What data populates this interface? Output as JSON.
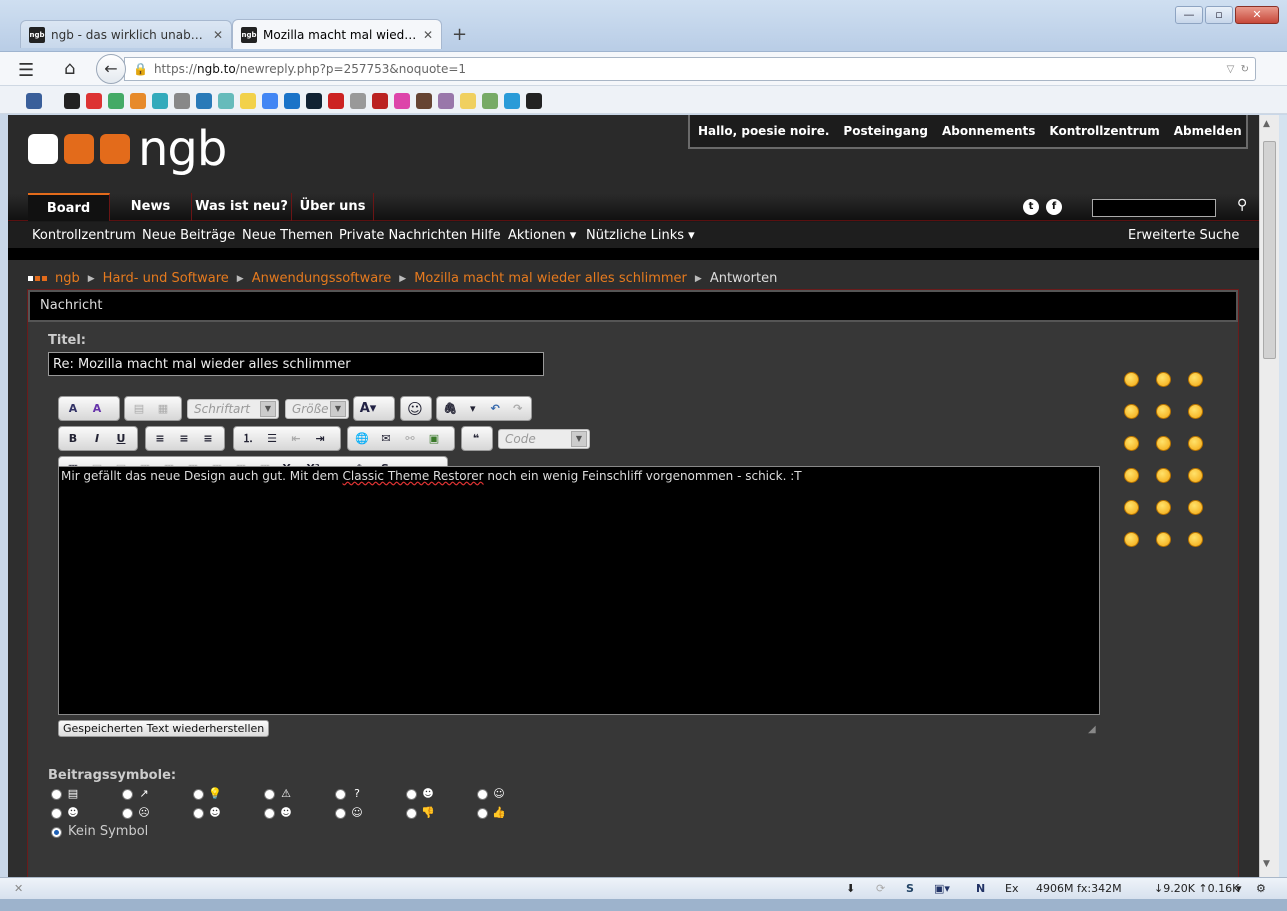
{
  "browser": {
    "tabs": [
      {
        "favicon": "ngb",
        "title": "ngb - das wirklich unabhä..."
      },
      {
        "favicon": "ngb",
        "title": "Mozilla macht mal wieder ..."
      }
    ],
    "url_scheme": "https://",
    "url_host": "ngb.to",
    "url_path": "/newreply.php?p=257753&noquote=1",
    "window_controls": {
      "minimize": "—",
      "maximize": "▫",
      "close": "✕"
    }
  },
  "site": {
    "logo_text": "ngb",
    "logo_colors": [
      "#ffffff",
      "#e36b1b",
      "#e36b1b"
    ],
    "user_menu": [
      "Hallo, poesie noire.",
      "Posteingang",
      "Abonnements",
      "Kontrollzentrum",
      "Abmelden"
    ],
    "main_nav": [
      "Board",
      "News",
      "Was ist neu?",
      "Über uns"
    ],
    "sub_nav": [
      "Kontrollzentrum",
      "Neue Beiträge",
      "Neue Themen",
      "Private Nachrichten",
      "Hilfe",
      "Aktionen ▾",
      "Nützliche Links ▾"
    ],
    "advanced_search": "Erweiterte Suche",
    "accent": "#e36b1b"
  },
  "breadcrumb": [
    "ngb",
    "Hard- und Software",
    "Anwendungssoftware",
    "Mozilla macht mal wieder alles schlimmer",
    "Antworten"
  ],
  "form": {
    "section_title": "Nachricht",
    "title_label": "Titel:",
    "title_value": "Re: Mozilla macht mal wieder alles schlimmer",
    "font_select": "Schriftart",
    "size_select": "Größe",
    "code_select": "Code",
    "message_pre": "Mir gefällt das neue Design auch gut. Mit dem ",
    "message_spell": "Classic Theme Restorer",
    "message_post": " noch ein wenig Feinschliff vorgenommen - schick. :T",
    "restore_button": "Gespeicherten Text wiederherstellen",
    "post_icons_label": "Beitragssymbole:",
    "no_icon_label": "Kein Symbol"
  },
  "statusbar": {
    "memory": "4906M fx:342M",
    "traffic": "↓9.20K ↑0.16K"
  }
}
